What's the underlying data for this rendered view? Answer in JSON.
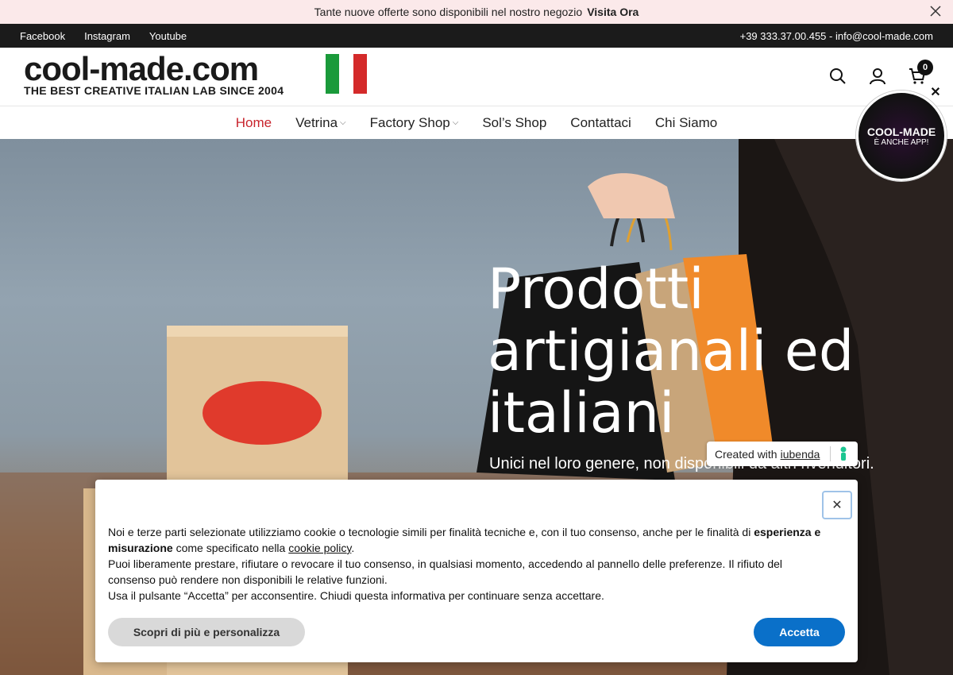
{
  "announcement": {
    "text": "Tante nuove offerte sono disponibili nel nostro negozio",
    "link": "Visita Ora"
  },
  "topbar": {
    "social": [
      "Facebook",
      "Instagram",
      "Youtube"
    ],
    "contact": "+39 333.37.00.455 - info@cool-made.com"
  },
  "logo": {
    "name": "cool-made.com",
    "tagline": "THE BEST CREATIVE ITALIAN LAB SINCE 2004"
  },
  "cart": {
    "count": "0"
  },
  "nav": {
    "items": [
      "Home",
      "Vetrina",
      "Factory Shop",
      "Sol’s Shop",
      "Contattaci",
      "Chi Siamo"
    ]
  },
  "hero": {
    "title": "Prodotti artigianali ed italiani",
    "subtitle": "Unici nel loro genere, non disponibili da altri rivenditori."
  },
  "app_badge": {
    "line1": "COOL-MADE",
    "line2": "È ANCHE APP!"
  },
  "iubenda": {
    "prefix": "Created with",
    "link": "iubenda"
  },
  "cookie": {
    "p1_a": "Noi e terze parti selezionate utilizziamo cookie o tecnologie simili per finalità tecniche e, con il tuo consenso, anche per le finalità di",
    "p1_b": "esperienza e misurazione",
    "p1_c": "come specificato nella",
    "p1_link": "cookie policy",
    "p2": "Puoi liberamente prestare, rifiutare o revocare il tuo consenso, in qualsiasi momento, accedendo al pannello delle preferenze. Il rifiuto del consenso può rendere non disponibili le relative funzioni.",
    "p3": "Usa il pulsante “Accetta” per acconsentire. Chiudi questa informativa per continuare senza accettare.",
    "btn_more": "Scopri di più e personalizza",
    "btn_accept": "Accetta"
  },
  "colors": {
    "accent": "#c8232c",
    "accept": "#0a70c9"
  }
}
